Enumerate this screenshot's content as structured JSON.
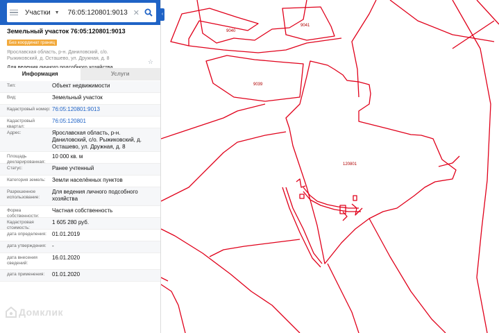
{
  "search": {
    "layer": "Участки",
    "query": "76:05:120801:9013",
    "clear_icon": "close-icon"
  },
  "parcel": {
    "title": "Земельный участок 76:05:120801:9013",
    "badge": "Без координат границ",
    "address_short": "Ярославская область, р-н. Даниловский, с/о. Рыжиковский, д. Осташево, ул. Дружная, д. 8",
    "purpose": "Для ведения личного подсобного хозяйства"
  },
  "tabs": [
    "Информация",
    "Услуги"
  ],
  "info_rows": [
    {
      "key": "Тип:",
      "value": "Объект недвижимости",
      "link": false
    },
    {
      "key": "Вид:",
      "value": "Земельный участок",
      "link": false
    },
    {
      "key": "Кадастровый номер:",
      "value": "76:05:120801:9013",
      "link": true
    },
    {
      "key": "Кадастровый квартал:",
      "value": "76:05:120801",
      "link": true
    },
    {
      "key": "Адрес:",
      "value": "Ярославская область, р-н. Даниловский, с/о. Рыжиковский, д. Осташево, ул. Дружная, д. 8",
      "link": false
    },
    {
      "key": "Площадь декларированная:",
      "value": "10 000 кв. м",
      "link": false
    },
    {
      "key": "Статус:",
      "value": "Ранее учтенный",
      "link": false
    },
    {
      "key": "Категория земель:",
      "value": "Земли населённых пунктов",
      "link": false
    },
    {
      "key": "Разрешенное использование:",
      "value": "Для ведения личного подсобного хозяйства",
      "link": false
    },
    {
      "key": "Форма собственности:",
      "value": "Частная собственность",
      "link": false
    },
    {
      "key": "Кадастровая стоимость:",
      "value": "1 605 280 руб.",
      "link": false
    },
    {
      "key": "дата определения:",
      "value": "01.01.2019",
      "link": false
    },
    {
      "key": "дата утверждения:",
      "value": "-",
      "link": false
    },
    {
      "key": "дата внесения сведений:",
      "value": "16.01.2020",
      "link": false
    },
    {
      "key": "дата применения:",
      "value": "01.01.2020",
      "link": false
    }
  ],
  "map": {
    "parcel_labels": [
      "9040",
      "9041",
      "9039",
      "120801"
    ],
    "boundary_color": "#e0001a"
  },
  "watermark": "Домклик"
}
